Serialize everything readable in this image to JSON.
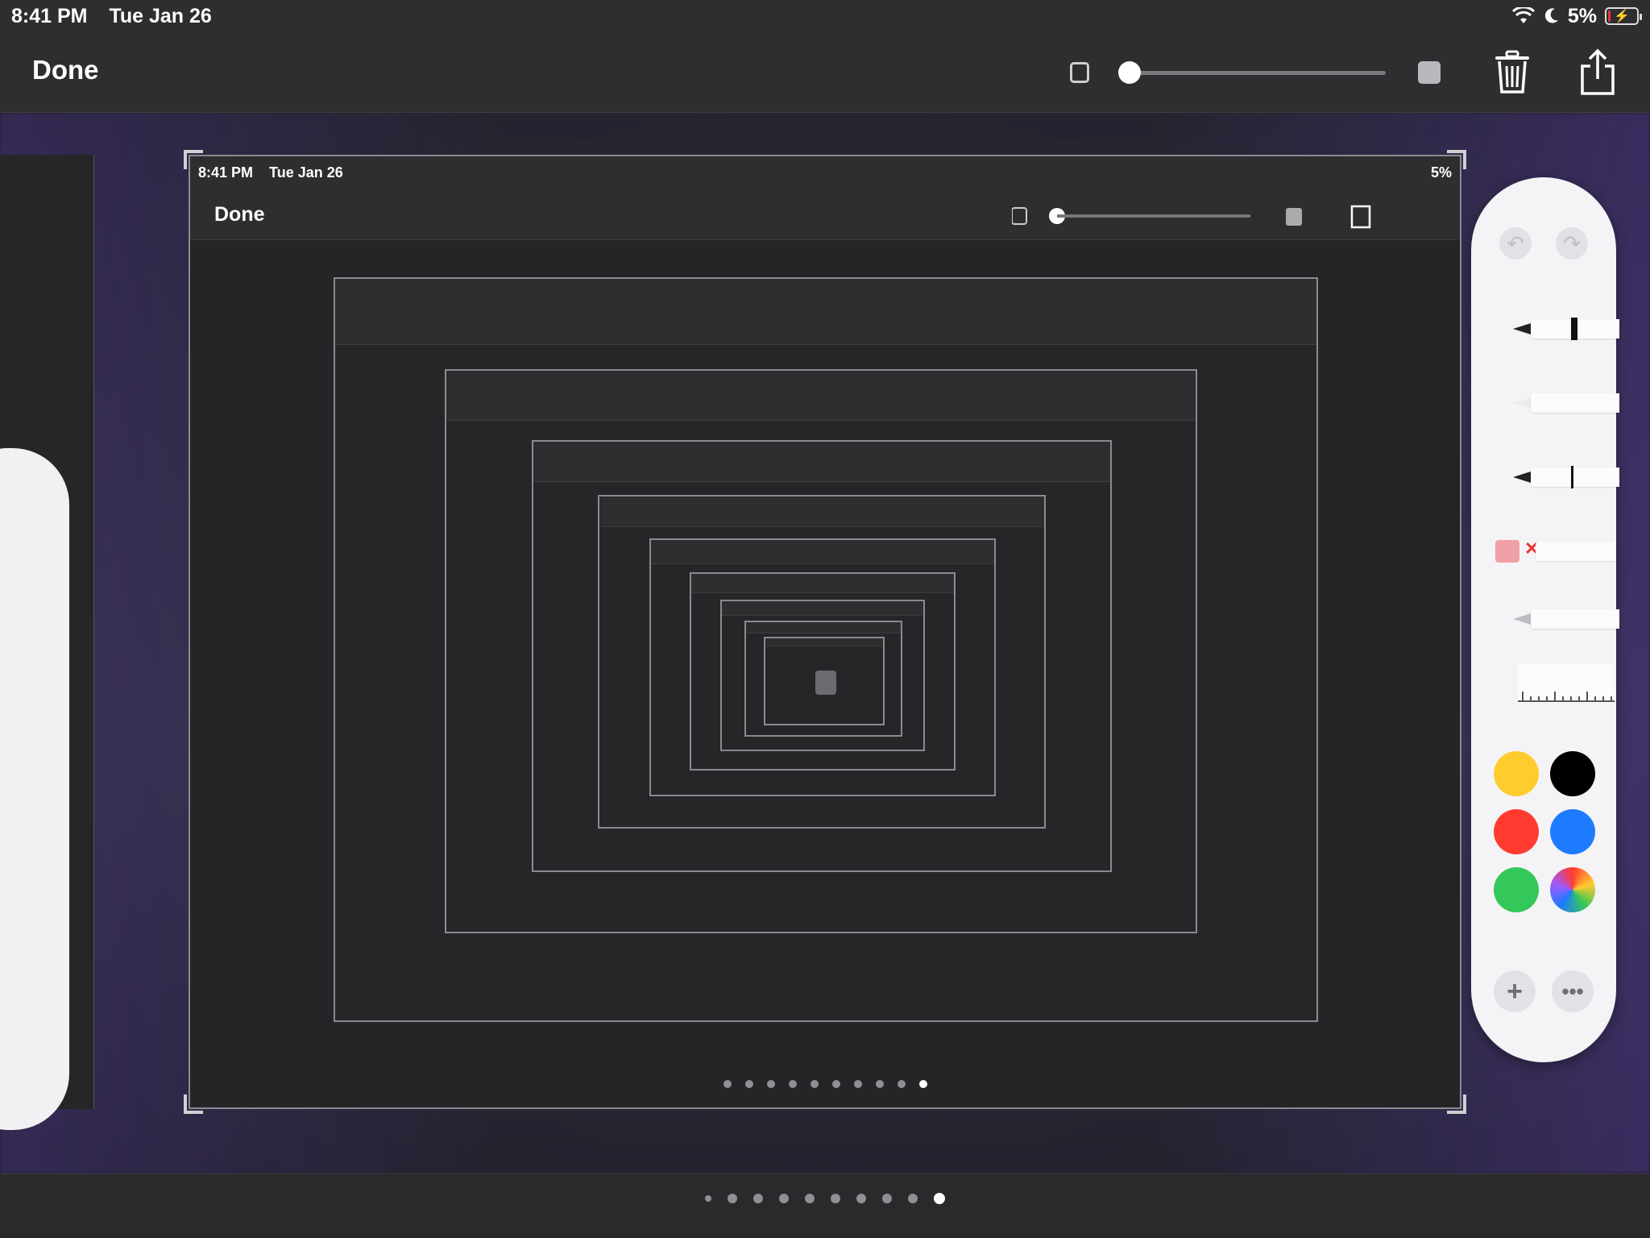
{
  "status_bar": {
    "time": "8:41 PM",
    "date": "Tue Jan 26",
    "battery": "5%"
  },
  "toolbar": {
    "done_label": "Done"
  },
  "frame": {
    "time": "8:41 PM",
    "date": "Tue Jan 26",
    "battery": "5%",
    "done_label": "Done"
  },
  "palette": {
    "colors": [
      "#FFCC2E",
      "#000000",
      "#FF3B30",
      "#1E7BFF",
      "#34C759",
      "multicolor"
    ]
  },
  "page_dots": {
    "count": 10,
    "active_index": 9
  }
}
